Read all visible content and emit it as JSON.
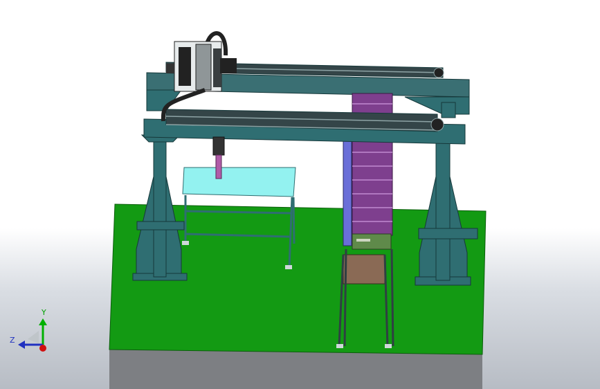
{
  "viewport": {
    "background_top": "#ffffff",
    "background_bottom": "#b7bcc4"
  },
  "colors": {
    "floor_green": "#139a13",
    "floor_side": "#7d7f83",
    "frame_teal": "#2f6e72",
    "frame_dark": "#1f4a4d",
    "beam": "#3a6f73",
    "table_top": "#93f2f0",
    "stack_purple": "#7e3f8e",
    "stack_blue": "#6a6fd8",
    "box_brown": "#8a6a55",
    "tray_green": "#5f8a4a"
  },
  "triad": {
    "y_label": "Y",
    "z_label": "Z",
    "y_color": "#00b000",
    "z_color": "#2030c0",
    "x_color": "#d01010"
  }
}
